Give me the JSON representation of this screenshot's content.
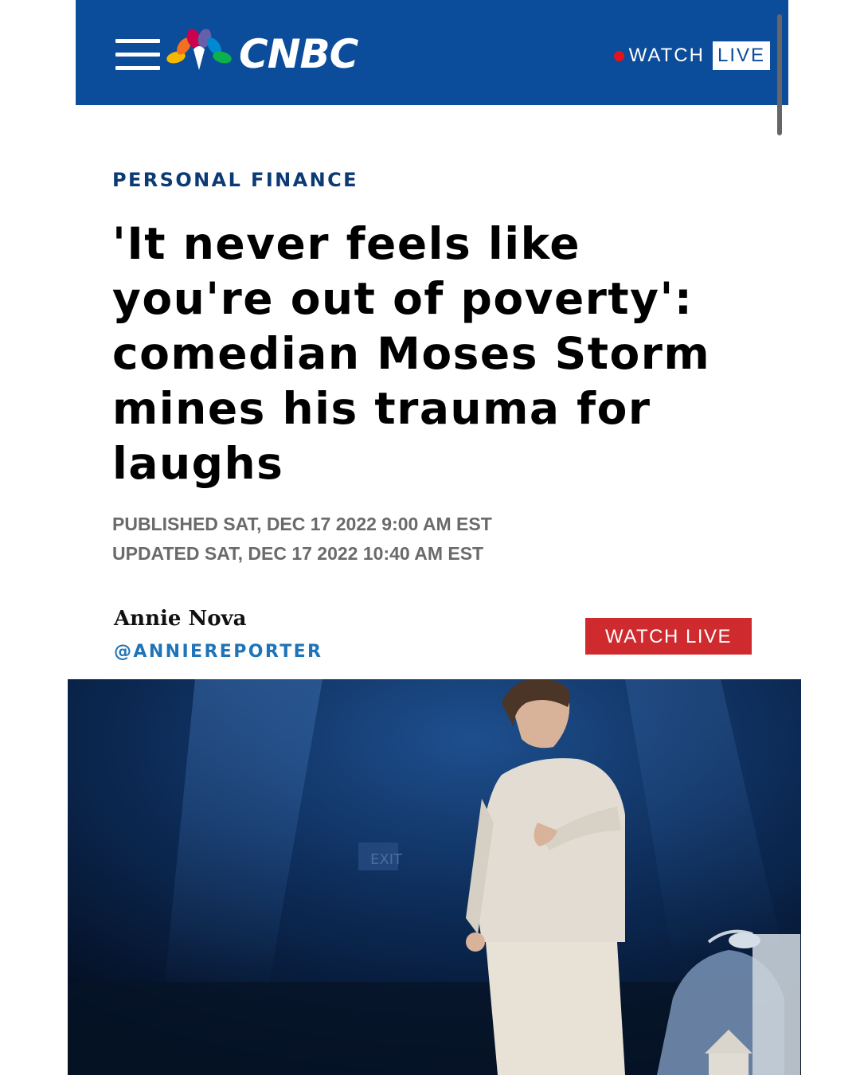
{
  "header": {
    "brand": "CNBC",
    "watch_label": "WATCH",
    "live_label": "LIVE",
    "background": "#0b4c9b"
  },
  "article": {
    "section": "PERSONAL FINANCE",
    "headline": "'It never feels like you're out of poverty': comedian Moses Storm mines his trauma for laughs",
    "published": "PUBLISHED SAT, DEC 17 2022 9:00 AM EST",
    "updated": "UPDATED SAT, DEC 17 2022 10:40 AM EST",
    "author": "Annie Nova",
    "author_handle": "@ANNIEREPORTER",
    "watch_live_button": "WATCH LIVE",
    "hero_exit_sign": "EXIT"
  },
  "colors": {
    "accent_red": "#cf2a2e",
    "section_blue": "#0b3a74",
    "handle_blue": "#1f74b8"
  },
  "icons": [
    "hamburger-menu-icon",
    "nbc-peacock-icon",
    "live-record-dot-icon"
  ]
}
